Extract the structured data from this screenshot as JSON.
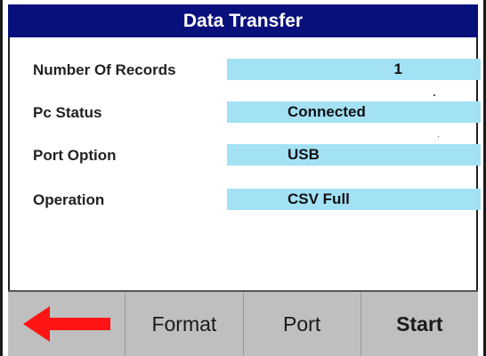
{
  "window": {
    "title": "Data Transfer"
  },
  "fields": [
    {
      "label": "Number Of Records",
      "value": "1"
    },
    {
      "label": "Pc Status",
      "value": "Connected"
    },
    {
      "label": "Port Option",
      "value": "USB"
    },
    {
      "label": "Operation",
      "value": "CSV Full"
    }
  ],
  "buttons": {
    "back_icon": "left-arrow-icon",
    "format_label": "Format",
    "port_label": "Port",
    "start_label": "Start"
  },
  "colors": {
    "title_bar": "#08107c",
    "field_background": "#a3e1f5",
    "button_bar": "#bfbfbf",
    "back_arrow": "#ff1414"
  }
}
